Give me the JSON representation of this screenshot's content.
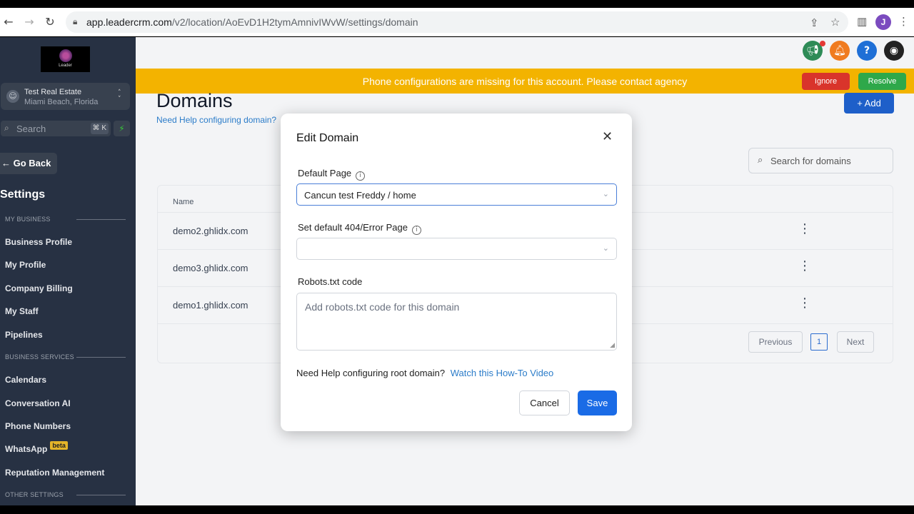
{
  "browser": {
    "url_host": "app.leadercrm.com",
    "url_path": "/v2/location/AoEvD1H2tymAmnivIWvW/settings/domain",
    "profile_initial": "J"
  },
  "sidebar": {
    "logo_text": "Leader",
    "location": {
      "name": "Test Real Estate",
      "sub": "Miami Beach, Florida"
    },
    "search_placeholder": "Search",
    "search_shortcut": "⌘ K",
    "go_back": "Go Back",
    "settings_title": "Settings",
    "sections": [
      {
        "label": "MY BUSINESS",
        "items": [
          "Business Profile",
          "My Profile",
          "Company Billing",
          "My Staff",
          "Pipelines"
        ]
      },
      {
        "label": "BUSINESS SERVICES",
        "items": [
          "Calendars",
          "Conversation AI",
          "Phone Numbers",
          "WhatsApp",
          "Reputation Management"
        ]
      },
      {
        "label": "OTHER SETTINGS",
        "items": []
      }
    ],
    "beta_badge": "beta"
  },
  "banner": {
    "message": "Phone configurations are missing for this account. Please contact agency",
    "ignore": "Ignore",
    "resolve": "Resolve"
  },
  "page": {
    "title": "Domains",
    "help_link": "Need Help configuring domain?",
    "add_button": "+ Add",
    "search_placeholder": "Search for domains",
    "table_header_name": "Name",
    "rows": [
      "demo2.ghlidx.com",
      "demo3.ghlidx.com",
      "demo1.ghlidx.com"
    ],
    "pagination": {
      "previous": "Previous",
      "page": "1",
      "next": "Next"
    }
  },
  "modal": {
    "title": "Edit Domain",
    "default_page_label": "Default Page",
    "default_page_value": "Cancun test Freddy / home",
    "error_page_label": "Set default 404/Error Page",
    "error_page_value": "",
    "robots_label": "Robots.txt code",
    "robots_placeholder": "Add robots.txt code for this domain",
    "help_text": "Need Help configuring root domain?",
    "help_link": "Watch this How-To Video",
    "cancel": "Cancel",
    "save": "Save"
  },
  "colors": {
    "sidebar_bg": "#273143",
    "banner_bg": "#f3b300",
    "primary": "#1a6be6",
    "link": "#2b7cc9"
  },
  "icons": {
    "header": [
      "megaphone-icon",
      "bell-icon",
      "help-icon",
      "avatar"
    ]
  }
}
